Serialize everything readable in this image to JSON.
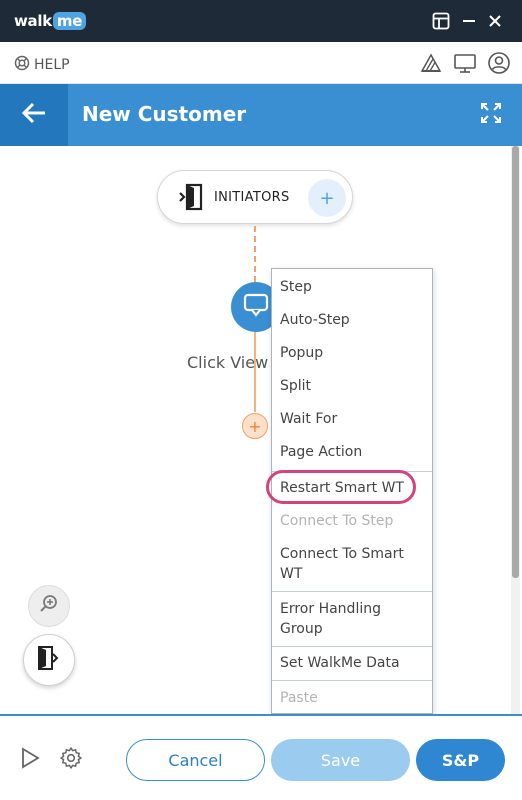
{
  "app": {
    "logo_prefix": "walk",
    "logo_suffix": "me",
    "window_icons": [
      "layout-icon",
      "minimize-icon",
      "close-icon"
    ]
  },
  "helpbar": {
    "help_label": "HELP",
    "icons": [
      "palette-icon",
      "monitor-icon",
      "user-icon"
    ]
  },
  "header": {
    "title": "New Customer",
    "accent_color": "#3a8fd3"
  },
  "flow": {
    "initiators_label": "INITIATORS",
    "step_label": "Click View"
  },
  "menu": {
    "items": [
      {
        "label": "Step",
        "enabled": true
      },
      {
        "label": "Auto-Step",
        "enabled": true
      },
      {
        "label": "Popup",
        "enabled": true
      },
      {
        "label": "Split",
        "enabled": true
      },
      {
        "label": "Wait For",
        "enabled": true
      },
      {
        "label": "Page Action",
        "enabled": true
      },
      {
        "label": "Restart Smart WT",
        "enabled": true,
        "highlighted": true
      },
      {
        "label": "Connect To Step",
        "enabled": false
      },
      {
        "label": "Connect To Smart WT",
        "enabled": true
      },
      {
        "label": "Error Handling Group",
        "enabled": true
      },
      {
        "label": "Set WalkMe Data",
        "enabled": true
      },
      {
        "label": "Paste",
        "enabled": false
      }
    ]
  },
  "footer": {
    "cancel_label": "Cancel",
    "save_label": "Save",
    "sp_label": "S&P"
  }
}
